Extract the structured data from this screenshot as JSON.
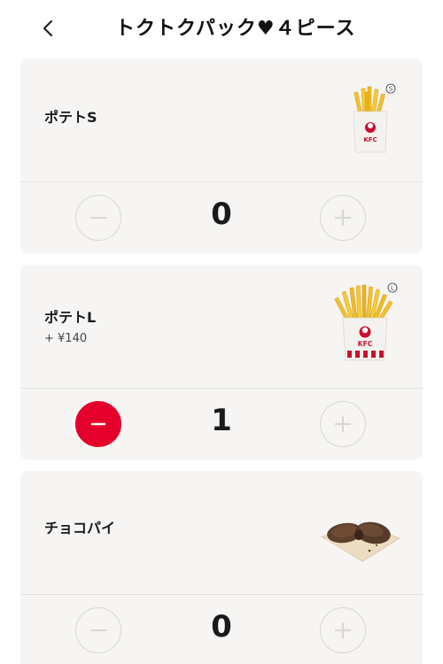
{
  "header": {
    "title": "トクトクパック♥４ピース",
    "back_icon": "chevron-left-icon"
  },
  "colors": {
    "accent": "#e4002b",
    "card_bg": "#f6f5f3",
    "disabled": "#d8d6d3"
  },
  "items": [
    {
      "name": "ポテトS",
      "price": "",
      "quantity": "0",
      "size_badge": "S",
      "image": "fries-small-image"
    },
    {
      "name": "ポテトL",
      "price": "+ ¥140",
      "quantity": "1",
      "size_badge": "L",
      "image": "fries-large-image"
    },
    {
      "name": "チョコパイ",
      "price": "",
      "quantity": "0",
      "size_badge": "",
      "image": "chocolate-pie-image"
    }
  ]
}
